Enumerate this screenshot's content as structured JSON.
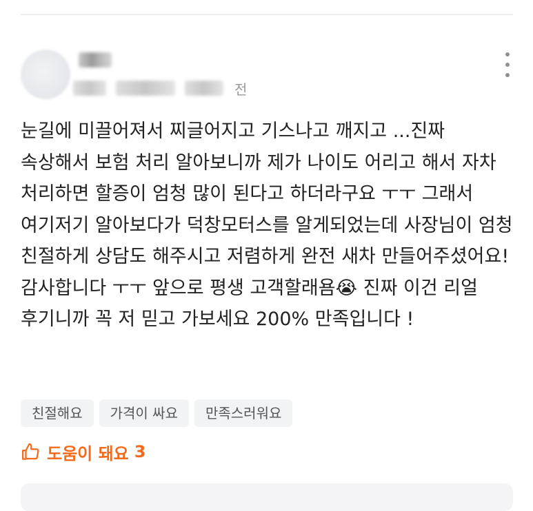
{
  "review": {
    "author": {
      "name": "■■",
      "name_blurred": true
    },
    "meta": {
      "blurred_segments": [
        "■■■",
        "■■■ ■■",
        "■■■"
      ],
      "ago_suffix": "전"
    },
    "text": "눈길에 미끌어져서 찌글어지고 기스나고 깨지고 ...진짜 속상해서 보험 처리 알아보니까 제가 나이도 어리고 해서 자차 처리하면 할증이 엄청 많이 된다고 하더라구요 ㅜㅜ 그래서 여기저기 알아보다가 덕창모터스를 알게되었는데 사장님이 엄청 친절하게 상담도 해주시고 저렴하게 완전 새차 만들어주셨어요! 감사합니다 ㅜㅜ 앞으로 평생 고객할래욤😭 진짜 이건 리얼 후기니까 꼭 저 믿고 가보세요 200% 만족입니다 !",
    "tags": [
      "친절해요",
      "가격이 싸요",
      "만족스러워요"
    ],
    "helpful": {
      "label": "도움이 돼요",
      "count": "3",
      "icon": "thumbs-up-icon"
    }
  },
  "colors": {
    "accent": "#f26b1d",
    "tag_bg": "#f2f3f5",
    "text": "#222222",
    "muted": "#999999"
  }
}
